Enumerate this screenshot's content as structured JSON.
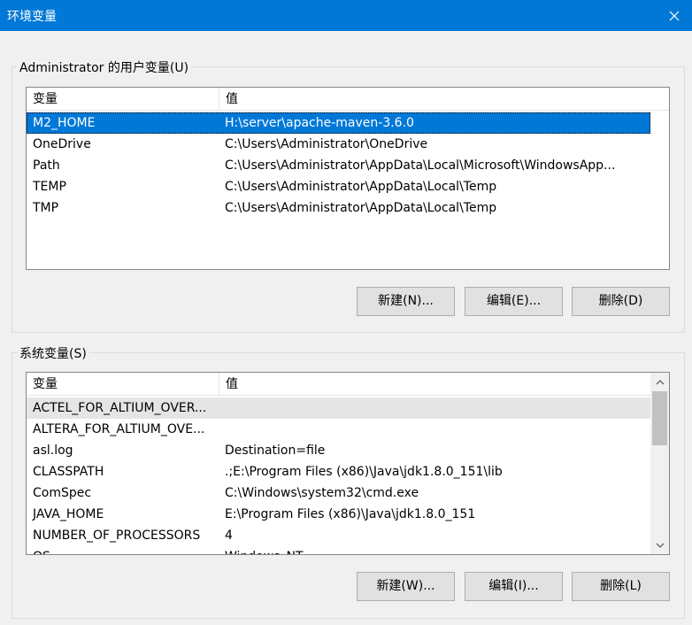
{
  "window": {
    "title": "环境变量",
    "close_icon": "close-icon"
  },
  "user_section": {
    "label": "Administrator 的用户变量(U)",
    "columns": [
      "变量",
      "值"
    ],
    "rows": [
      {
        "name": "M2_HOME",
        "value": "H:\\server\\apache-maven-3.6.0",
        "selected": true
      },
      {
        "name": "OneDrive",
        "value": "C:\\Users\\Administrator\\OneDrive"
      },
      {
        "name": "Path",
        "value": "C:\\Users\\Administrator\\AppData\\Local\\Microsoft\\WindowsApp..."
      },
      {
        "name": "TEMP",
        "value": "C:\\Users\\Administrator\\AppData\\Local\\Temp"
      },
      {
        "name": "TMP",
        "value": "C:\\Users\\Administrator\\AppData\\Local\\Temp"
      }
    ],
    "buttons": {
      "new": "新建(N)...",
      "edit": "编辑(E)...",
      "delete": "删除(D)"
    }
  },
  "system_section": {
    "label": "系统变量(S)",
    "columns": [
      "变量",
      "值"
    ],
    "rows": [
      {
        "name": "ACTEL_FOR_ALTIUM_OVER...",
        "value": "",
        "hover": true
      },
      {
        "name": "ALTERA_FOR_ALTIUM_OVE...",
        "value": ""
      },
      {
        "name": "asl.log",
        "value": "Destination=file"
      },
      {
        "name": "CLASSPATH",
        "value": ".;E:\\Program Files (x86)\\Java\\jdk1.8.0_151\\lib"
      },
      {
        "name": "ComSpec",
        "value": "C:\\Windows\\system32\\cmd.exe"
      },
      {
        "name": "JAVA_HOME",
        "value": "E:\\Program Files (x86)\\Java\\jdk1.8.0_151"
      },
      {
        "name": "NUMBER_OF_PROCESSORS",
        "value": "4"
      },
      {
        "name": "OS",
        "value": "Windows_NT"
      }
    ],
    "buttons": {
      "new": "新建(W)...",
      "edit": "编辑(I)...",
      "delete": "删除(L)"
    }
  },
  "colors": {
    "titlebar": "#0078d7",
    "selection": "#0078d7",
    "button": "#e1e1e1",
    "background": "#f0f0f0"
  }
}
